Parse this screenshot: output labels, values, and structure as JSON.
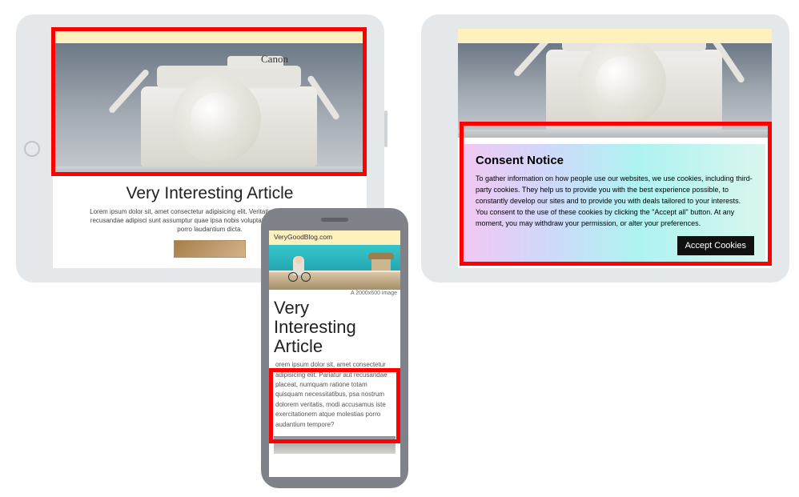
{
  "camera_brand": "Canon",
  "tablet1": {
    "article_title": "Very Interesting Article",
    "article_body": "Lorem ipsum dolor sit, amet consectetur adipisicing elit. Veritatis ad, sapiente beatae recusandae adipisci sunt assumptur quae ipsa nobis voluptate reprehenderit placeat porro laudantium dicta."
  },
  "tablet2": {
    "consent_title": "Consent Notice",
    "consent_body": "To gather information on how people use our websites, we use cookies, including third-party cookies. They help us to provide you with the best experience possible, to constantly develop our sites and to provide you with deals tailored to your interests. You consent to the use of these cookies by clicking the \"Accept all\" button. At any moment, you may withdraw your permission, or alter your preferences.",
    "accept_label": "Accept Cookies"
  },
  "phone": {
    "site_name": "VeryGoodBlog.com",
    "image_caption": "A 2000x600 image",
    "article_title": "Very Interesting Article",
    "article_body": "orem ipsum dolor sit, amet consectetur adipisicing elit. Pariatur aut recusandae placeat, numquam ratione totam quisquam necessitatibus, psa nostrum dolorem veritatis, modi accusamus iste exercitationem atque molestias porro audantium tempore?"
  }
}
